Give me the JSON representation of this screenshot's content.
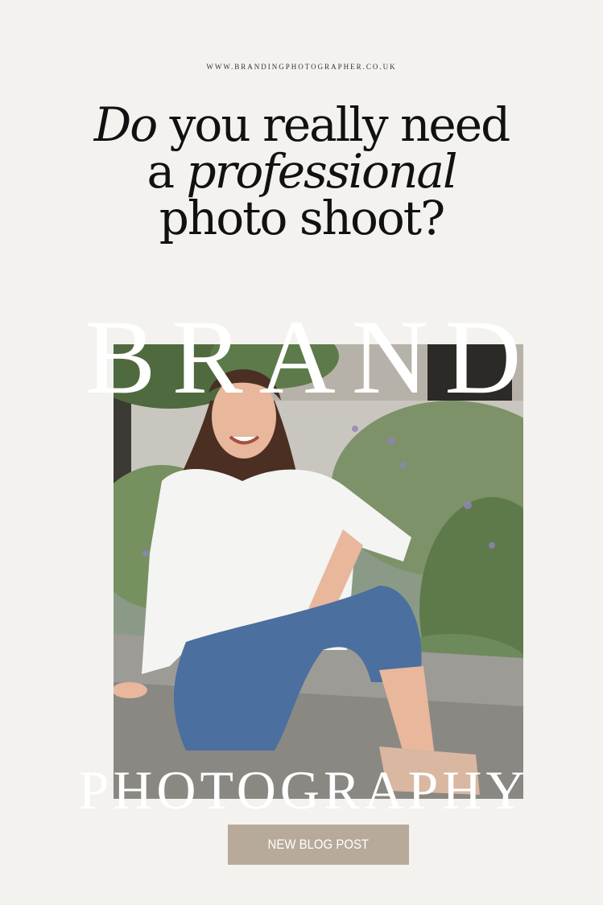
{
  "header": {
    "url": "WWW.BRANDINGPHOTOGRAPHER.CO.UK"
  },
  "headline": {
    "line1_italic": "Do",
    "line1_rest": " you really need",
    "line2_start": "a ",
    "line2_italic": "professional",
    "line3": "photo shoot?"
  },
  "overlay": {
    "top_word": "BRAND",
    "bottom_word": "PHOTOGRAPHY"
  },
  "cta": {
    "label": "NEW BLOG POST"
  },
  "colors": {
    "background": "#f3f2ee",
    "button": "#b7aa9b",
    "text": "#111111"
  }
}
